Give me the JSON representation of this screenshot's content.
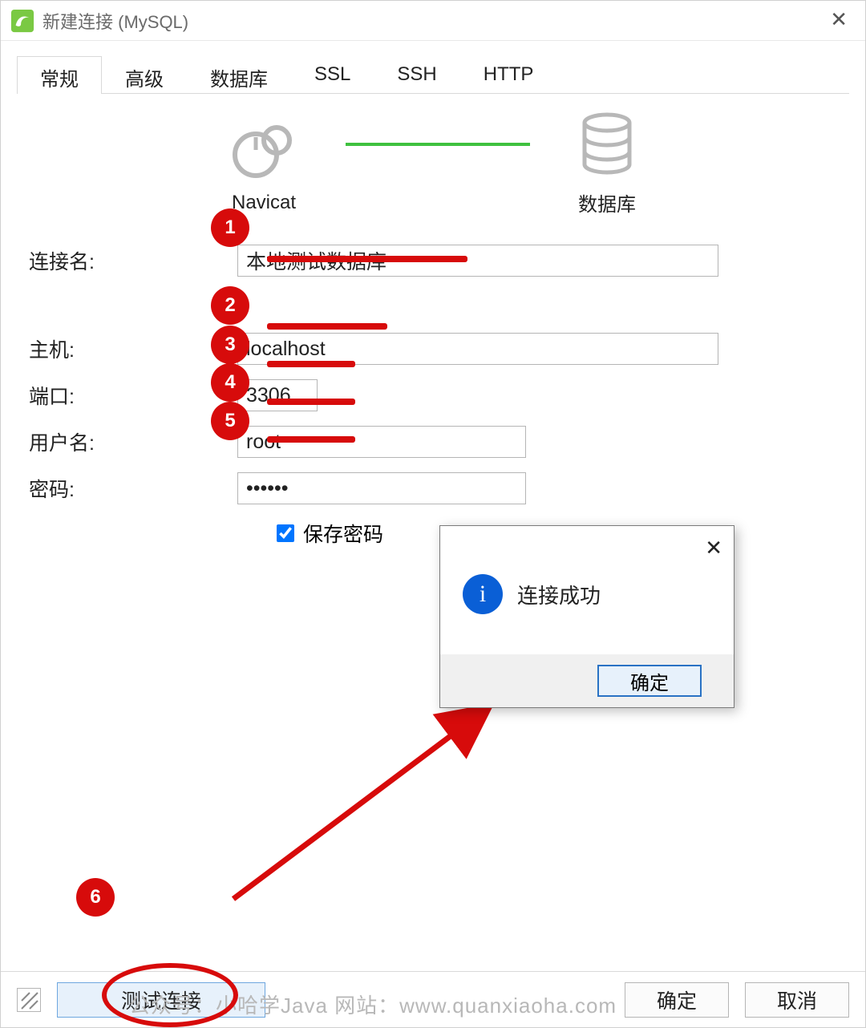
{
  "window": {
    "title": "新建连接 (MySQL)"
  },
  "tabs": [
    "常规",
    "高级",
    "数据库",
    "SSL",
    "SSH",
    "HTTP"
  ],
  "diagram": {
    "left_label": "Navicat",
    "right_label": "数据库"
  },
  "form": {
    "connection_name_label": "连接名:",
    "connection_name_value": "本地测试数据库",
    "host_label": "主机:",
    "host_value": "localhost",
    "port_label": "端口:",
    "port_value": "3306",
    "user_label": "用户名:",
    "user_value": "root",
    "password_label": "密码:",
    "password_value": "••••••",
    "save_password_label": "保存密码"
  },
  "popup": {
    "message": "连接成功",
    "ok": "确定"
  },
  "buttons": {
    "test": "测试连接",
    "ok": "确定",
    "cancel": "取消"
  },
  "annotations": {
    "badges": [
      "1",
      "2",
      "3",
      "4",
      "5",
      "6"
    ]
  },
  "watermark": "公众号：小哈学Java   网站：www.quanxiaoha.com"
}
